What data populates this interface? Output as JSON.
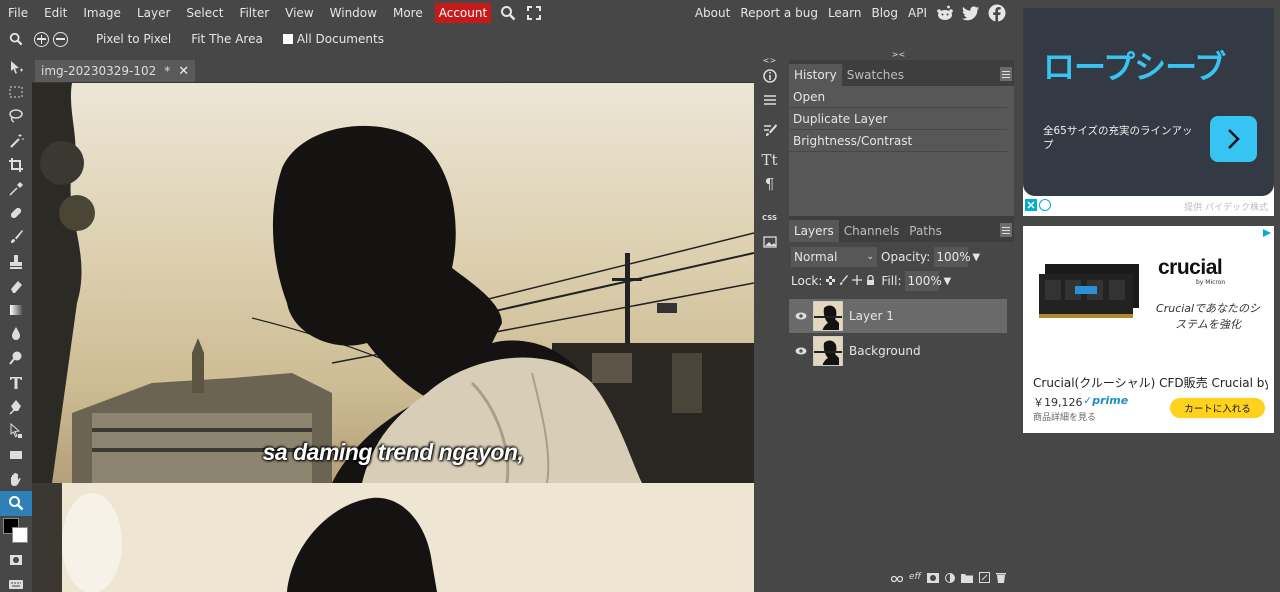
{
  "menu": {
    "items": [
      "File",
      "Edit",
      "Image",
      "Layer",
      "Select",
      "Filter",
      "View",
      "Window",
      "More"
    ],
    "account": "Account",
    "right_items": [
      "About",
      "Report a bug",
      "Learn",
      "Blog",
      "API"
    ]
  },
  "options": {
    "pixel_to_pixel": "Pixel to Pixel",
    "fit_area": "Fit The Area",
    "all_documents": "All Documents"
  },
  "document": {
    "tab_name": "img-20230329-102",
    "tab_modified": "*",
    "subtitle": "sa daming trend ngayon,"
  },
  "history": {
    "tabs": [
      "History",
      "Swatches"
    ],
    "items": [
      "Open",
      "Duplicate Layer",
      "Brightness/Contrast"
    ]
  },
  "layers": {
    "tabs": [
      "Layers",
      "Channels",
      "Paths"
    ],
    "blend_mode": "Normal",
    "opacity_label": "Opacity:",
    "opacity_value": "100%",
    "lock_label": "Lock:",
    "fill_label": "Fill:",
    "fill_value": "100%",
    "items": [
      {
        "name": "Layer 1",
        "selected": true
      },
      {
        "name": "Background",
        "selected": false
      }
    ],
    "footer_eff": "eff"
  },
  "ad1": {
    "title": "ロープシーブ",
    "desc": "全65サイズの充実のラインアップ",
    "sponsor": "提供 パイデック株式"
  },
  "ad2": {
    "brand": "crucial",
    "brand_sub": "by Micron",
    "tagline": "Crucialであなたのシステムを強化",
    "name": "Crucial(クルーシャル) CFD販売 Crucial by Micron",
    "price": "￥19,126",
    "prime": "✓prime",
    "detail": "商品詳細を見る",
    "cart": "カートに入れる"
  },
  "colors": {
    "accent": "#2f7fb9",
    "account_red": "#c41a1a",
    "panel_bg": "#474747",
    "ad_blue": "#38c4f2",
    "cart_yellow": "#ffd21e"
  }
}
